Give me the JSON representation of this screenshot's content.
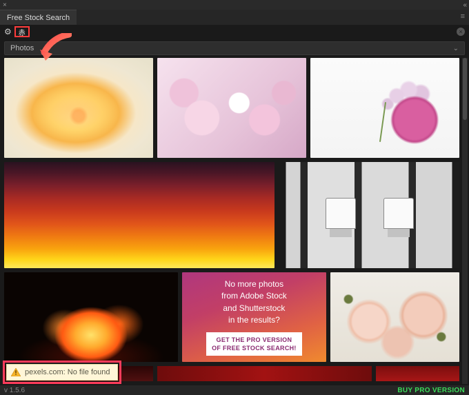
{
  "panel": {
    "title": "Free Stock Search"
  },
  "toolbar": {
    "search_value": "赤"
  },
  "dropdown": {
    "selected": "Photos"
  },
  "promo": {
    "line1": "No more photos",
    "line2": "from Adobe Stock",
    "line3": "and Shutterstock",
    "line4": "in the results?",
    "cta1": "GET THE PRO VERSION",
    "cta2": "OF FREE STOCK SEARCH!"
  },
  "notification": {
    "text": "pexels.com: No file found"
  },
  "footer": {
    "version": "v 1.5.6",
    "buy": "BUY PRO VERSION"
  }
}
